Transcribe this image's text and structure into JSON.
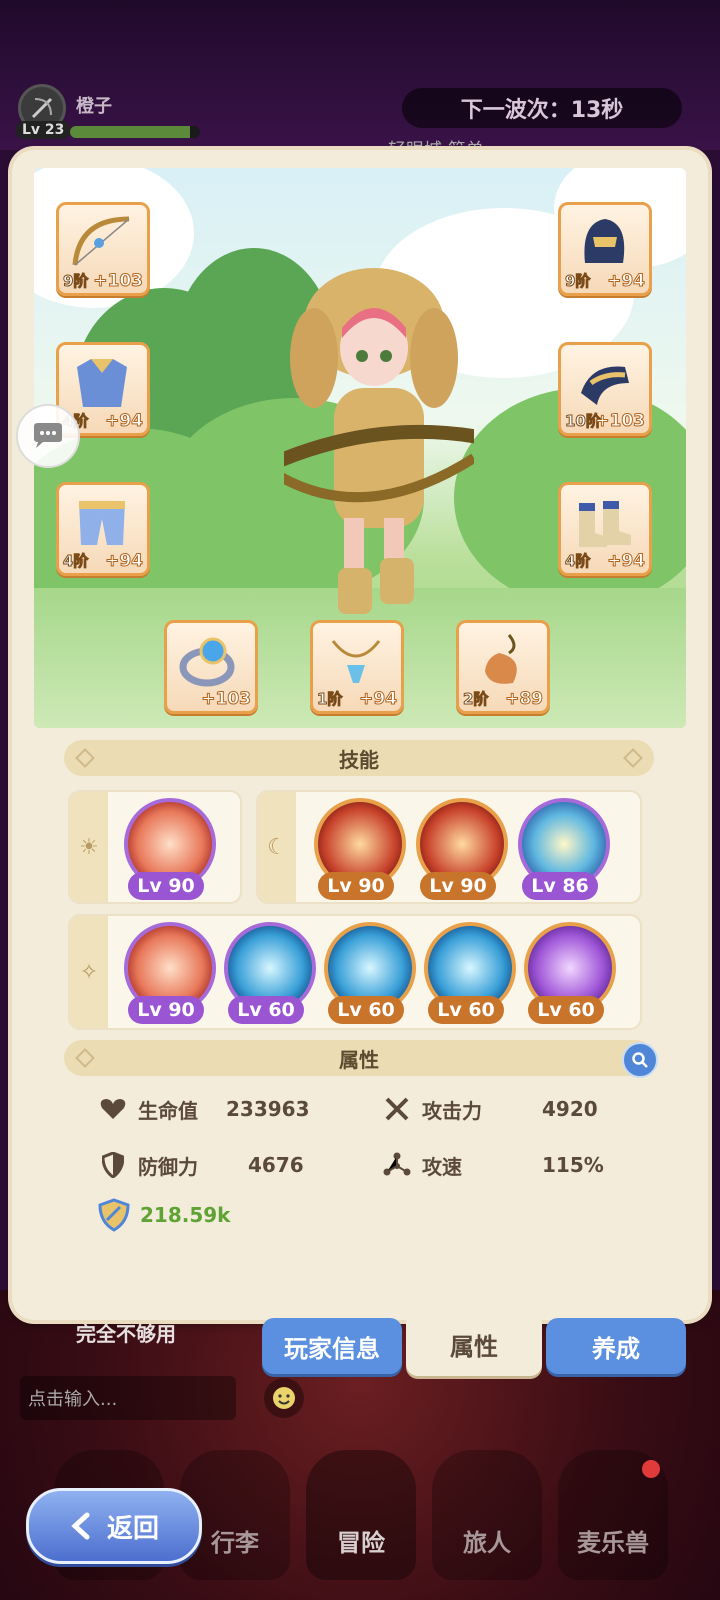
{
  "hud": {
    "player_name": "橙子",
    "level": "Lv 23",
    "xp_fraction": 0.92,
    "wave": "下一波次：13秒",
    "wave_sub": "轻眼城 简单"
  },
  "equipment": {
    "weapon": {
      "tier": "9阶",
      "plus": "+103"
    },
    "helmet": {
      "tier": "9阶",
      "plus": "+94"
    },
    "armor": {
      "tier": "4阶",
      "plus": "+94"
    },
    "gloves": {
      "tier": "10阶",
      "plus": "+103"
    },
    "pants": {
      "tier": "4阶",
      "plus": "+94"
    },
    "boots": {
      "tier": "4阶",
      "plus": "+94"
    },
    "ring": {
      "tier": "",
      "plus": "+103"
    },
    "necklace": {
      "tier": "1阶",
      "plus": "+94"
    },
    "charm": {
      "tier": "2阶",
      "plus": "+89"
    }
  },
  "skills_section": {
    "title": "技能"
  },
  "skills": {
    "passive": [
      {
        "level": "Lv 90"
      }
    ],
    "moon": [
      {
        "level": "Lv 90"
      },
      {
        "level": "Lv 90"
      },
      {
        "level": "Lv 86"
      }
    ],
    "star": [
      {
        "level": "Lv 90"
      },
      {
        "level": "Lv 60"
      },
      {
        "level": "Lv 60"
      },
      {
        "level": "Lv 60"
      },
      {
        "level": "Lv 60"
      }
    ]
  },
  "attributes_section": {
    "title": "属性"
  },
  "stats": {
    "hp": {
      "label": "生命值",
      "value": "233963"
    },
    "attack": {
      "label": "攻击力",
      "value": "4920"
    },
    "defense": {
      "label": "防御力",
      "value": "4676"
    },
    "speed": {
      "label": "攻速",
      "value": "115%"
    },
    "power": {
      "value": "218.59k"
    }
  },
  "tabs": {
    "player_info": "玩家信息",
    "attributes": "属性",
    "cultivate": "养成"
  },
  "chat": {
    "message": "完全不够用",
    "placeholder": "点击输入..."
  },
  "nav": {
    "bag": "行李",
    "adventure": "冒险",
    "traveler": "旅人",
    "pet": "麦乐兽"
  },
  "back": {
    "label": "返回"
  },
  "colors": {
    "accent_orange": "#e8a14a",
    "accent_purple": "#9a55d2",
    "tab_blue": "#5b8fe0",
    "power_green": "#5ea334"
  }
}
